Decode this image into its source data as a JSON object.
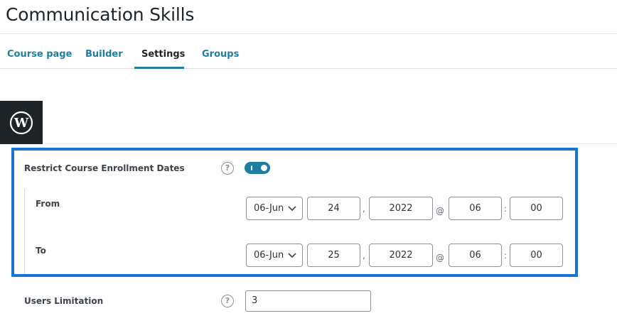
{
  "page": {
    "title": "Communication Skills"
  },
  "tabs": [
    {
      "label": "Course page"
    },
    {
      "label": "Builder"
    },
    {
      "label": "Settings"
    },
    {
      "label": "Groups"
    }
  ],
  "enrollment": {
    "label": "Restrict Course Enrollment Dates",
    "help": "?",
    "enabled": true,
    "from": {
      "label": "From",
      "month": "06-Jun",
      "day": "24",
      "year": "2022",
      "hour": "06",
      "minute": "00"
    },
    "to": {
      "label": "To",
      "month": "06-Jun",
      "day": "25",
      "year": "2022",
      "hour": "06",
      "minute": "00"
    },
    "sep_comma": ",",
    "sep_at": "@",
    "sep_colon": ":"
  },
  "users_limitation": {
    "label": "Users Limitation",
    "help": "?",
    "value": "3"
  },
  "colors": {
    "accent": "#1e7ea1",
    "highlight": "#1574d4"
  }
}
